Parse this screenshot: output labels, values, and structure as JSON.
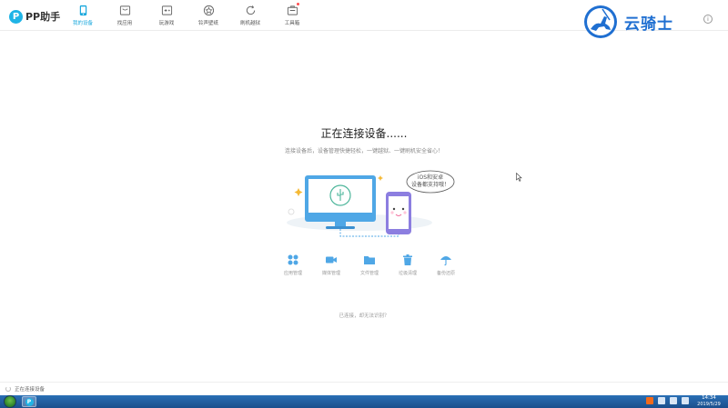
{
  "app": {
    "logo_mark": "P",
    "logo_text": "PP助手"
  },
  "nav": {
    "items": [
      {
        "label": "我的设备",
        "icon": "phone-device-icon",
        "active": true
      },
      {
        "label": "找应用",
        "icon": "store-icon",
        "active": false
      },
      {
        "label": "玩游戏",
        "icon": "gamepad-icon",
        "active": false
      },
      {
        "label": "铃声壁纸",
        "icon": "ringtone-icon",
        "active": false
      },
      {
        "label": "刷机越狱",
        "icon": "refresh-icon",
        "active": false
      },
      {
        "label": "工具箱",
        "icon": "toolbox-icon",
        "active": false
      }
    ]
  },
  "watermark": {
    "text": "云骑士"
  },
  "main": {
    "title": "正在连接设备......",
    "subtitle": "连接设备后，设备管理快捷轻松，一键越狱、一键刷机安全省心！",
    "bubble_line1": "iOS和安卓",
    "bubble_line2": "设备都支持哦！",
    "features": [
      {
        "label": "应用管理",
        "icon": "apps-grid-icon"
      },
      {
        "label": "媒体管理",
        "icon": "video-camera-icon"
      },
      {
        "label": "文件管理",
        "icon": "folder-icon"
      },
      {
        "label": "垃圾清理",
        "icon": "trash-icon"
      },
      {
        "label": "备份还原",
        "icon": "umbrella-icon"
      }
    ],
    "help_link": "已连接，却无法识别？"
  },
  "status": {
    "text": "正在连接设备"
  },
  "taskbar": {
    "time": "14:34",
    "date": "2019/5/29"
  },
  "colors": {
    "accent": "#1aa8dd",
    "icon_blue": "#4fa7e6",
    "phone_purple": "#8c7ee0"
  }
}
